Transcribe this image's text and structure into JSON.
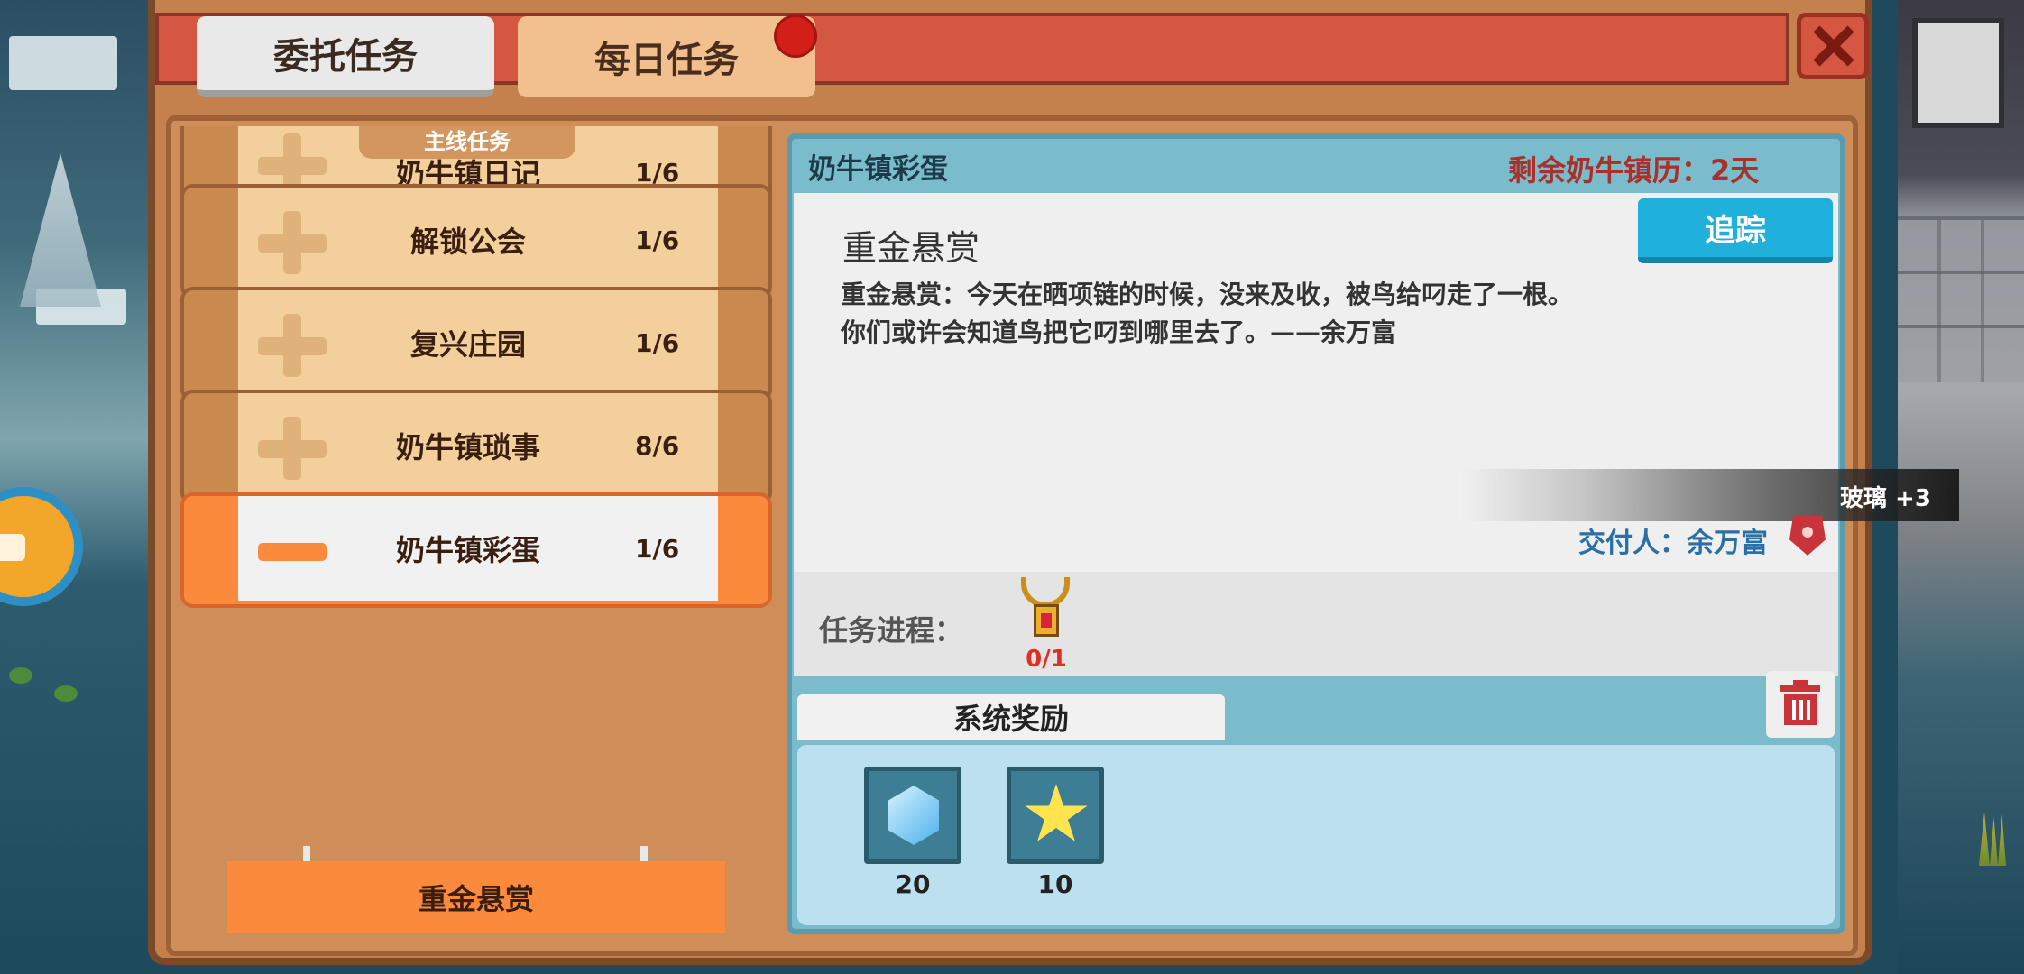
{
  "tabs": {
    "entrust": "委托任务",
    "daily": "每日任务"
  },
  "quest_list": {
    "section_label": "主线任务",
    "items": [
      {
        "name": "奶牛镇日记",
        "progress": "1/6"
      },
      {
        "name": "解锁公会",
        "progress": "1/6"
      },
      {
        "name": "复兴庄园",
        "progress": "1/6"
      },
      {
        "name": "奶牛镇琐事",
        "progress": "8/6"
      },
      {
        "name": "奶牛镇彩蛋",
        "progress": "1/6"
      }
    ],
    "sub_task": "重金悬赏"
  },
  "detail": {
    "category": "奶牛镇彩蛋",
    "remaining_days": "剩余奶牛镇历：2天",
    "quest_name": "重金悬赏",
    "track_button": "追踪",
    "description": "重金悬赏：今天在晒项链的时候，没来及收，被鸟给叼走了一根。\n你们或许会知道鸟把它叼到哪里去了。——余万富",
    "giver": "交付人：余万富",
    "progress_label": "任务进程：",
    "progress_item": {
      "icon": "necklace-icon",
      "count": "0/1"
    }
  },
  "rewards": {
    "tab_label": "系统奖励",
    "items": [
      {
        "icon": "gem-icon",
        "count": "20"
      },
      {
        "icon": "star-icon",
        "count": "10"
      }
    ]
  },
  "toast": "玻璃 +3",
  "colors": {
    "top_bar": "#d55742",
    "panel": "#c5814d",
    "active_quest": "#fb8a3c",
    "detail_frame": "#7bbccc",
    "track_button": "#1fb1dc",
    "alert": "#a8322b"
  }
}
